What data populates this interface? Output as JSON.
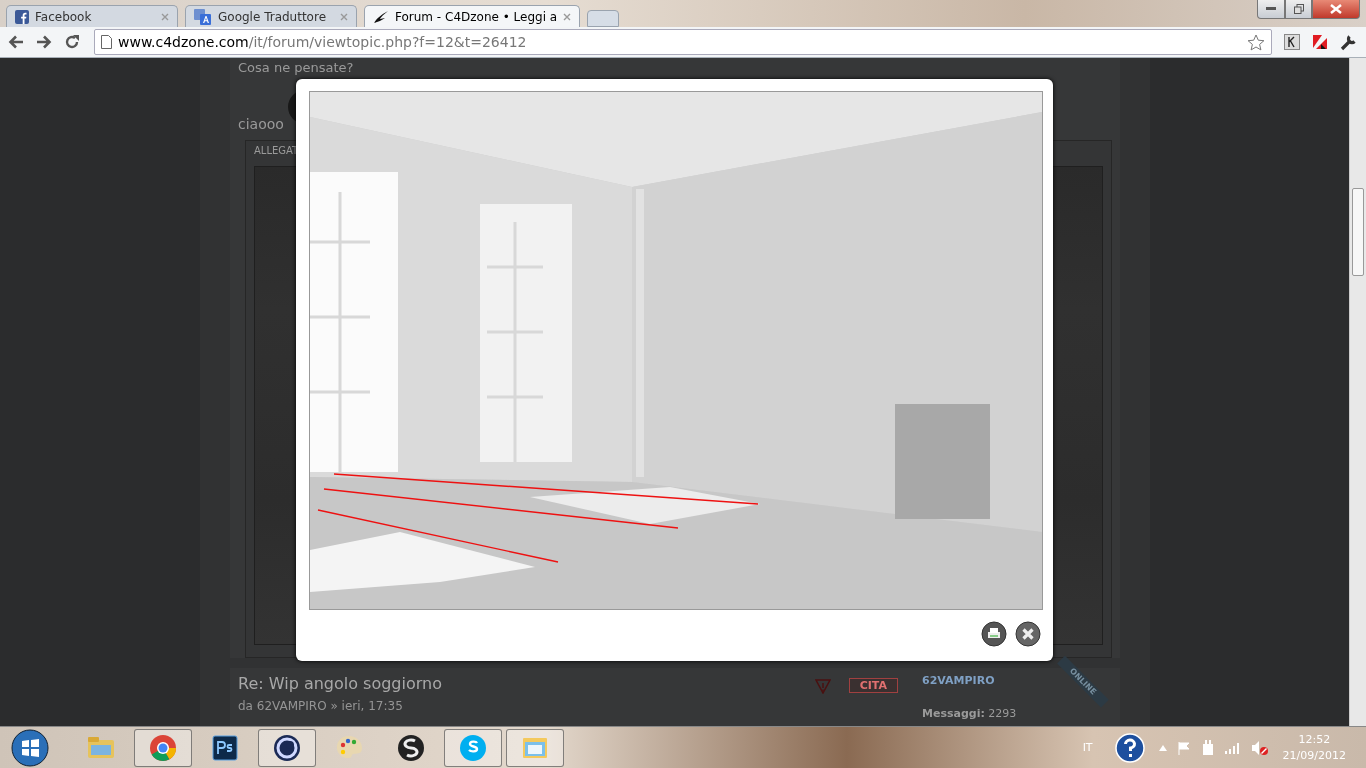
{
  "tabs": [
    {
      "label": "Facebook",
      "kind": "facebook",
      "selected": false
    },
    {
      "label": "Google Traduttore",
      "kind": "translate",
      "selected": false
    },
    {
      "label": "Forum - C4Dzone • Leggi a",
      "kind": "forum",
      "selected": true
    }
  ],
  "address_bar": {
    "host": "www.c4dzone.com",
    "path": "/it/forum/viewtopic.php?f=12&t=26412"
  },
  "post": {
    "text": "Cosa ne pensate?",
    "reply": "ciaooo",
    "attachments_label": "ALLEGAT"
  },
  "next_post": {
    "title": "Re: Wip angolo soggiorno",
    "byline": "da 62VAMPIRO » ieri, 17:35",
    "quote_button": "CITA",
    "author": "62VAMPIRO",
    "status": "ONLINE",
    "posts_label": "Messaggi:",
    "posts_count": "2293"
  },
  "taskbar": {
    "apps": [
      {
        "kind": "folder",
        "running": false
      },
      {
        "kind": "chrome",
        "running": true
      },
      {
        "kind": "photoshop",
        "running": false
      },
      {
        "kind": "cinema",
        "running": true
      },
      {
        "kind": "palette",
        "running": false
      },
      {
        "kind": "swirl",
        "running": false
      },
      {
        "kind": "skype",
        "running": true
      },
      {
        "kind": "window",
        "running": true
      }
    ],
    "language": "IT",
    "time": "12:52",
    "date": "21/09/2012"
  }
}
